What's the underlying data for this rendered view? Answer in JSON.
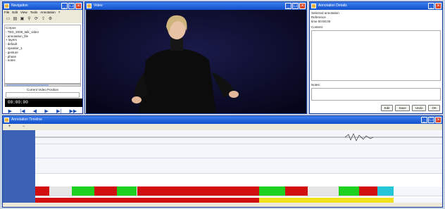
{
  "nav_window": {
    "title": "Navigation",
    "menu": [
      "File",
      "Edit",
      "View",
      "Tools",
      "Annotation",
      "?"
    ],
    "tree": [
      "Corpus",
      "- TED_2008_talk_video",
      "- annotation_file",
      "  + layers",
      "    - default",
      "    - speaker_1",
      "    - gesture",
      "    - phase",
      "    - notes"
    ],
    "field_label": "Current Video Position",
    "field_value": "",
    "timecode": "00:00:00",
    "timecode_sub": "",
    "transport": [
      "play-icon",
      "prev-icon",
      "step-back-icon",
      "step-forward-icon",
      "next-icon",
      "end-icon"
    ]
  },
  "video_window": {
    "title": "Video"
  },
  "notes_window": {
    "title": "Annotation Details",
    "lines": [
      "Selected annotation",
      "Reference",
      "time 00:00:00"
    ],
    "section_label": "Content:",
    "section2_label": "Notes:",
    "buttons": [
      "Edit",
      "Save",
      "Undo",
      "OK"
    ]
  },
  "timeline_window": {
    "title": "Annotation Timeline",
    "rows": [
      {
        "label": ""
      },
      {
        "label": ""
      },
      {
        "label": ""
      },
      {
        "label": ""
      }
    ],
    "tracks": [
      [
        {
          "start": 0,
          "end": 3.5,
          "color": "#d10f0f",
          "text": ""
        },
        {
          "start": 3.5,
          "end": 9.0,
          "color": "#e6e6e6",
          "text": ""
        },
        {
          "start": 9.0,
          "end": 14.5,
          "color": "#1fd11f",
          "text": ""
        },
        {
          "start": 14.5,
          "end": 20.0,
          "color": "#d10f0f",
          "text": ""
        },
        {
          "start": 20.0,
          "end": 25.0,
          "color": "#1fd11f",
          "text": ""
        },
        {
          "start": 25.0,
          "end": 55.0,
          "color": "#d10f0f",
          "text": ""
        },
        {
          "start": 55.0,
          "end": 61.5,
          "color": "#1fd11f",
          "text": ""
        },
        {
          "start": 61.5,
          "end": 67.0,
          "color": "#d10f0f",
          "text": ""
        },
        {
          "start": 67.0,
          "end": 74.5,
          "color": "#e6e6e6",
          "text": ""
        },
        {
          "start": 74.5,
          "end": 79.5,
          "color": "#1fd11f",
          "text": ""
        },
        {
          "start": 79.5,
          "end": 84.0,
          "color": "#d10f0f",
          "text": ""
        },
        {
          "start": 84.0,
          "end": 88.0,
          "color": "#26c6d9",
          "text": ""
        }
      ],
      [
        {
          "start": 0,
          "end": 55.0,
          "color": "#d10f0f",
          "text": ""
        },
        {
          "start": 55.0,
          "end": 88.0,
          "color": "#f1e11c",
          "text": ""
        }
      ]
    ]
  },
  "colors": {
    "titlebar": "#1150c9",
    "label_column": "#3c62b5",
    "video_bg": "#0a0a26"
  }
}
